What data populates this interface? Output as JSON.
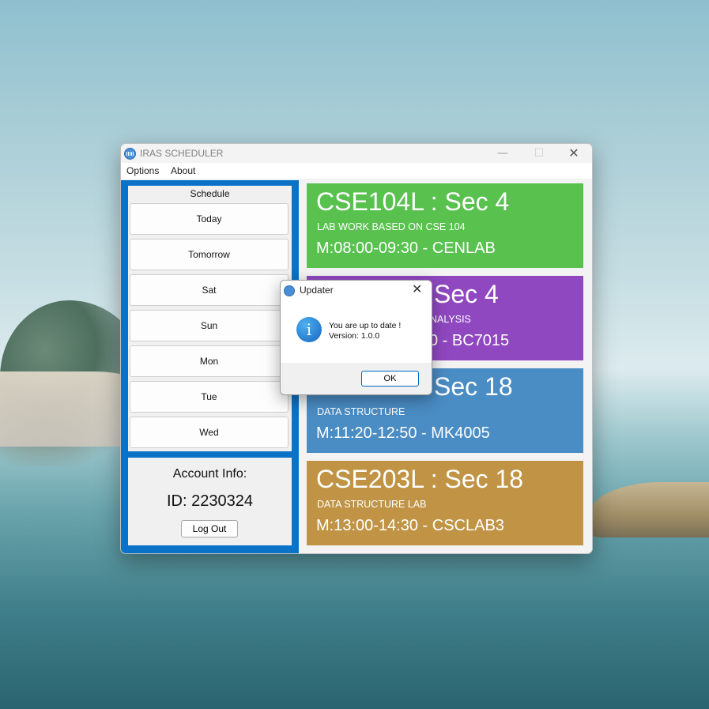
{
  "window": {
    "title": "IRAS SCHEDULER",
    "controls": {
      "minimize": "—",
      "maximize": "☐",
      "close": "✕"
    }
  },
  "menu": {
    "items": [
      "Options",
      "About"
    ]
  },
  "schedule": {
    "label": "Schedule",
    "days": [
      "Today",
      "Tomorrow",
      "Sat",
      "Sun",
      "Mon",
      "Tue",
      "Wed"
    ]
  },
  "account": {
    "title": "Account Info:",
    "id": "ID: 2230324",
    "logout_label": "Log Out"
  },
  "cards": [
    {
      "title": "CSE104L : Sec 4",
      "subtitle": "LAB WORK BASED ON CSE 104",
      "time": "M:08:00-09:30 - CENLAB",
      "color": "#59c24f"
    },
    {
      "title": "Sec 4",
      "subtitle": "NALYSIS",
      "time": "0 - BC7015",
      "color": "#8f48c0"
    },
    {
      "title": "Sec 18",
      "subtitle": "DATA STRUCTURE",
      "time": "M:11:20-12:50 - MK4005",
      "color": "#4a8cc4"
    },
    {
      "title": "CSE203L : Sec 18",
      "subtitle": "DATA STRUCTURE LAB",
      "time": "M:13:00-14:30 - CSCLAB3",
      "color": "#c09444"
    }
  ],
  "dialog": {
    "title": "Updater",
    "close": "✕",
    "icon": "info-icon",
    "line1": "You are up to date !",
    "line2": "Version: 1.0.0",
    "ok_label": "OK"
  }
}
